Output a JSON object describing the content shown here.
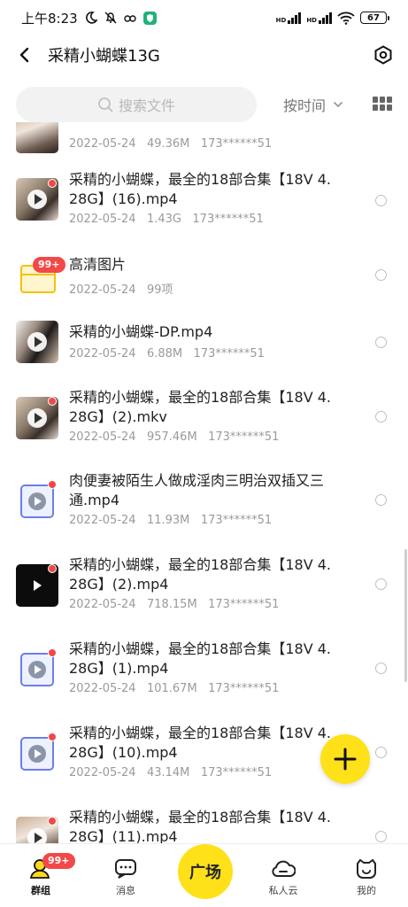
{
  "status_bar": {
    "time": "上午8:23",
    "signal1_label": "HD",
    "signal2_label": "HD",
    "battery": "67"
  },
  "header": {
    "title": "采精小蝴蝶13G"
  },
  "toolbar": {
    "search_placeholder": "搜索文件",
    "sort_label": "按时间"
  },
  "files": [
    {
      "name": "",
      "date": "2022-05-24",
      "size": "49.36M",
      "owner": "173******51"
    },
    {
      "name": "采精的小蝴蝶，最全的18部合集【18V 4.28G】(16).mp4",
      "date": "2022-05-24",
      "size": "1.43G",
      "owner": "173******51"
    },
    {
      "name": "高清图片",
      "date": "2022-05-24",
      "size": "99项",
      "owner": "",
      "badge": "99+"
    },
    {
      "name": "采精的小蝴蝶-DP.mp4",
      "date": "2022-05-24",
      "size": "6.88M",
      "owner": "173******51"
    },
    {
      "name": "采精的小蝴蝶，最全的18部合集【18V 4.28G】(2).mkv",
      "date": "2022-05-24",
      "size": "957.46M",
      "owner": "173******51"
    },
    {
      "name": "肉便妻被陌生人做成淫肉三明治双插又三通.mp4",
      "date": "2022-05-24",
      "size": "11.93M",
      "owner": "173******51"
    },
    {
      "name": "采精的小蝴蝶，最全的18部合集【18V 4.28G】(2).mp4",
      "date": "2022-05-24",
      "size": "718.15M",
      "owner": "173******51"
    },
    {
      "name": "采精的小蝴蝶，最全的18部合集【18V 4.28G】(1).mp4",
      "date": "2022-05-24",
      "size": "101.67M",
      "owner": "173******51"
    },
    {
      "name": "采精的小蝴蝶，最全的18部合集【18V 4.28G】(10).mp4",
      "date": "2022-05-24",
      "size": "43.14M",
      "owner": "173******51"
    },
    {
      "name": "采精的小蝴蝶，最全的18部合集【18V 4.28G】(11).mp4",
      "date": "",
      "size": "",
      "owner": ""
    }
  ],
  "bottom_nav": {
    "groups": "群组",
    "groups_badge": "99+",
    "messages": "消息",
    "plaza": "广场",
    "private_cloud": "私人云",
    "mine": "我的"
  },
  "colors": {
    "accent_yellow": "#ffe11a",
    "badge_red": "#f24848",
    "meta_gray": "#9a9a9a"
  }
}
